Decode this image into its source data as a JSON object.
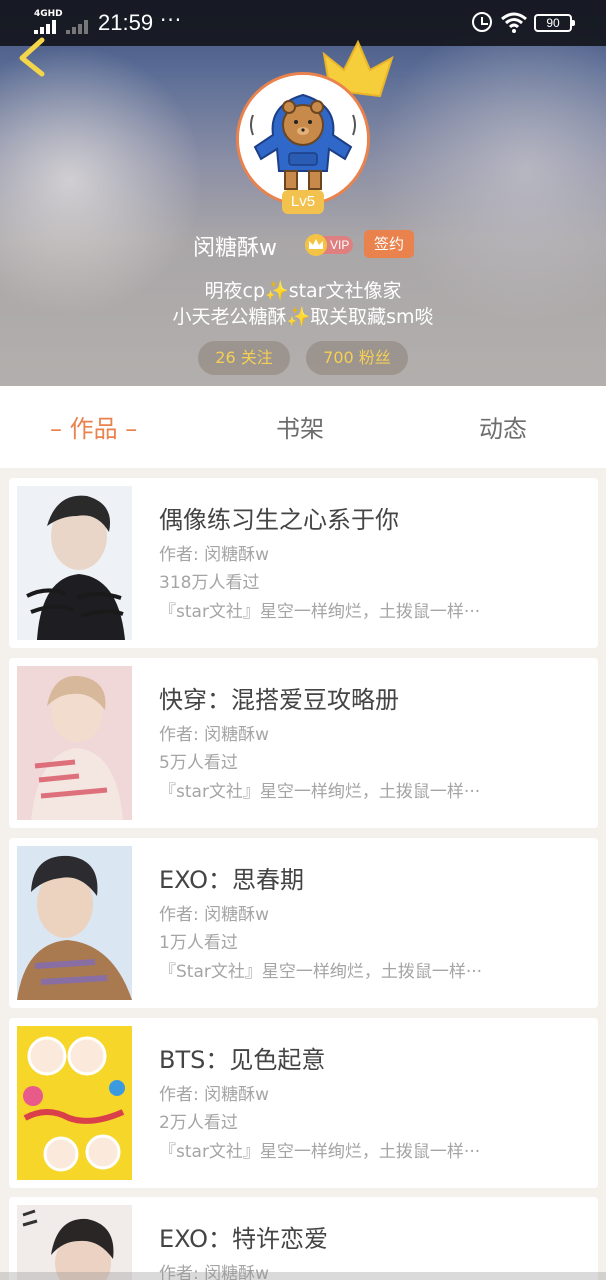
{
  "status_bar": {
    "network": "4GHD",
    "time": "21:59",
    "dots": "···",
    "battery": "90"
  },
  "profile": {
    "level": "Lv5",
    "username": "闵糖酥w",
    "vip_label": "VIP",
    "sign_label": "签约",
    "bio_line1_a": "明夜cp",
    "bio_line1_b": "star文社像家",
    "bio_line2_a": "小天老公糖酥",
    "bio_line2_b": "取关取藏sm啖",
    "sparkle": "✨",
    "following": "26 关注",
    "fans": "700 粉丝",
    "accent_color": "#e9824d"
  },
  "tabs": [
    {
      "label": "– 作品 –",
      "active": true
    },
    {
      "label": "书架",
      "active": false
    },
    {
      "label": "动态",
      "active": false
    }
  ],
  "books": [
    {
      "title": "偶像练习生之心系于你",
      "author": "作者: 闵糖酥w",
      "reads": "318万人看过",
      "desc": "『star文社』星空一样绚烂，土拨鼠一样···"
    },
    {
      "title": "快穿：混搭爱豆攻略册",
      "author": "作者: 闵糖酥w",
      "reads": "5万人看过",
      "desc": "『star文社』星空一样绚烂，土拨鼠一样···"
    },
    {
      "title": "EXO：思春期",
      "author": "作者: 闵糖酥w",
      "reads": "1万人看过",
      "desc": "『Star文社』星空一样绚烂，土拨鼠一样···"
    },
    {
      "title": "BTS：见色起意",
      "author": "作者: 闵糖酥w",
      "reads": "2万人看过",
      "desc": "『star文社』星空一样绚烂，土拨鼠一样···"
    },
    {
      "title": "EXO：特许恋爱",
      "author": "作者: 闵糖酥w",
      "reads": "",
      "desc": ""
    }
  ]
}
